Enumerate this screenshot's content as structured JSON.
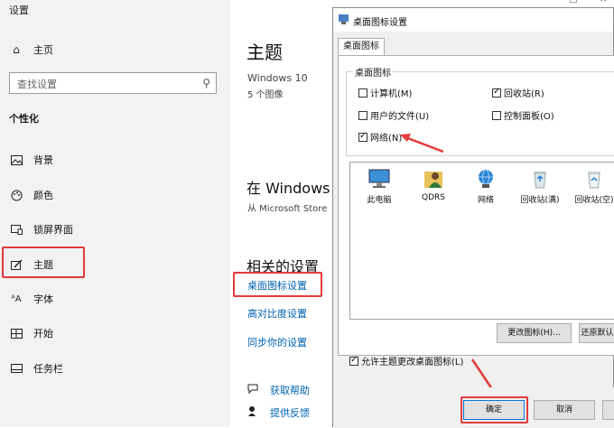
{
  "settings": {
    "window_title": "设置",
    "home": "主页",
    "search_placeholder": "查找设置",
    "section": "个性化",
    "nav": [
      "背景",
      "颜色",
      "锁屏界面",
      "主题",
      "字体",
      "开始",
      "任务栏"
    ]
  },
  "main": {
    "title": "主题",
    "theme_name": "Windows 10",
    "theme_count": "5 个图像",
    "store_title": "在 Windows 中",
    "store_sub": "从 Microsoft Store",
    "related_title": "相关的设置",
    "links": [
      "桌面图标设置",
      "高对比度设置",
      "同步你的设置"
    ],
    "help": [
      "获取帮助",
      "提供反馈"
    ]
  },
  "dialog": {
    "title": "桌面图标设置",
    "tab": "桌面图标",
    "group_label": "桌面图标",
    "checks": {
      "computer": "计算机(M)",
      "recycle": "回收站(R)",
      "userfiles": "用户的文件(U)",
      "control": "控制面板(O)",
      "network": "网络(N)"
    },
    "icons": [
      "此电脑",
      "QDRS",
      "网络",
      "回收站(满)",
      "回收站(空)"
    ],
    "change_icon": "更改图标(H)...",
    "restore_default": "还原默认",
    "allow_theme": "允许主题更改桌面图标(L)",
    "ok": "确定",
    "cancel": "取消"
  },
  "colors": {
    "accent_link": "#0063b1",
    "highlight_red": "#e23b3b"
  }
}
